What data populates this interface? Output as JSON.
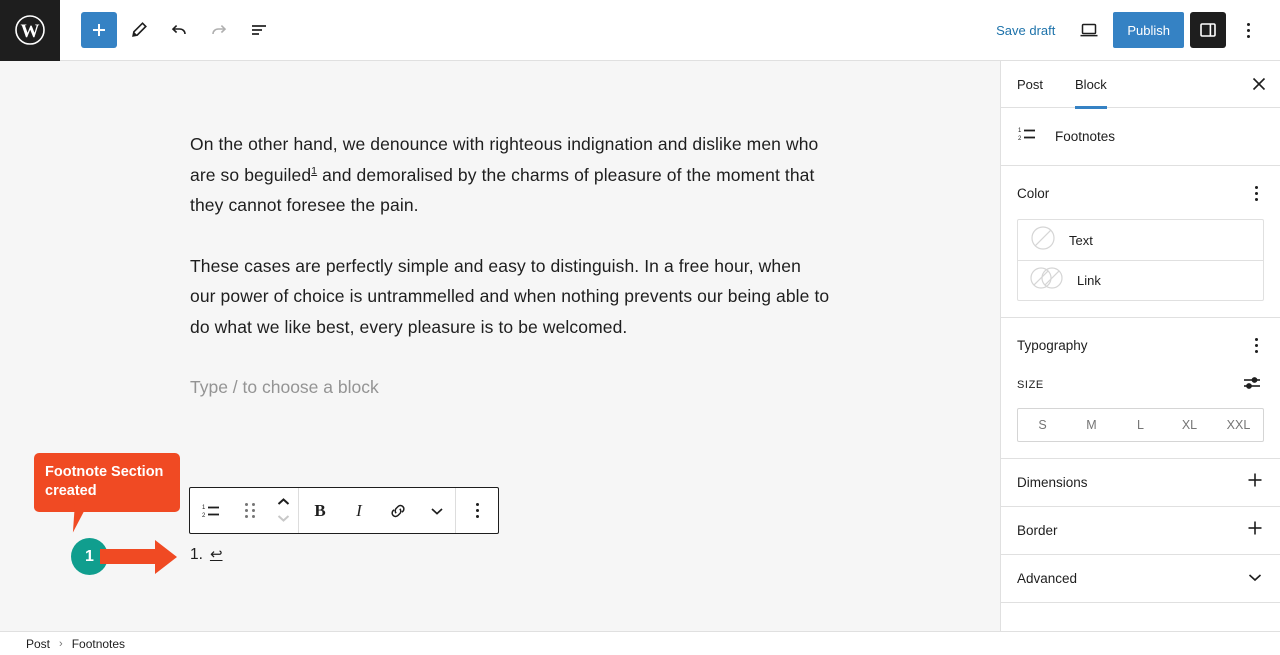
{
  "topbar": {
    "logo_icon": "wordpress-logo-icon",
    "add_block_label": "+",
    "tools": [
      {
        "name": "add-block-button",
        "icon": "plus-icon"
      },
      {
        "name": "edit-tools-button",
        "icon": "pencil-icon"
      },
      {
        "name": "undo-button",
        "icon": "undo-icon"
      },
      {
        "name": "redo-button",
        "icon": "redo-icon"
      },
      {
        "name": "document-overview-button",
        "icon": "list-view-icon"
      }
    ],
    "save_draft_label": "Save draft",
    "preview_icon": "laptop-preview-icon",
    "publish_label": "Publish",
    "sidebar_toggle_icon": "sidebar-panel-icon",
    "options_icon": "more-vertical-icon",
    "accent_blue": "#3582c4",
    "link_blue": "#1d72aa"
  },
  "editor": {
    "paragraph_1_before": "On the other hand, we denounce with righteous indignation and dislike men who are so beguiled",
    "footnote_ref": "1",
    "paragraph_1_after": " and demoralised by the charms of pleasure of the moment that they cannot foresee the pain.",
    "paragraph_2": "These cases are perfectly simple and easy to distinguish. In a free hour, when our power of choice is untrammelled and when nothing prevents our being able to do what we like best, every pleasure is to be welcomed.",
    "placeholder": "Type / to choose a block",
    "footnote_item_number": "1.",
    "footnote_backlink_icon": "return-arrow-icon",
    "footnote_backlink_glyph": "↩"
  },
  "block_toolbar": {
    "block_type_icon": "ordered-list-icon",
    "drag_handle_icon": "drag-handle-icon",
    "move_up_icon": "chevron-up-icon",
    "move_down_icon": "chevron-down-icon",
    "bold_label": "B",
    "italic_label": "I",
    "link_icon": "link-icon",
    "more_rich_text_icon": "chevron-down-icon",
    "options_icon": "more-vertical-icon"
  },
  "annotation": {
    "callout_text": "Footnote Section created",
    "step_number": "1",
    "callout_color": "#f04a23",
    "badge_color": "#109e8e"
  },
  "sidebar": {
    "tabs": [
      {
        "label": "Post",
        "active": false
      },
      {
        "label": "Block",
        "active": true
      }
    ],
    "close_icon": "close-icon",
    "block_icon": "ordered-list-icon",
    "block_name": "Footnotes",
    "color": {
      "title": "Color",
      "options_icon": "more-vertical-icon",
      "rows": [
        {
          "label": "Text",
          "swatch": "single-circle-swatch"
        },
        {
          "label": "Link",
          "swatch": "double-circle-swatch"
        }
      ]
    },
    "typography": {
      "title": "Typography",
      "options_icon": "more-vertical-icon",
      "size_label": "SIZE",
      "size_settings_icon": "sliders-icon",
      "sizes": [
        "S",
        "M",
        "L",
        "XL",
        "XXL"
      ]
    },
    "collapsible": [
      {
        "label": "Dimensions",
        "icon": "plus-icon"
      },
      {
        "label": "Border",
        "icon": "plus-icon"
      },
      {
        "label": "Advanced",
        "icon": "chevron-down-icon"
      }
    ]
  },
  "footer": {
    "crumbs": [
      "Post",
      "Footnotes"
    ],
    "separator": "›"
  }
}
